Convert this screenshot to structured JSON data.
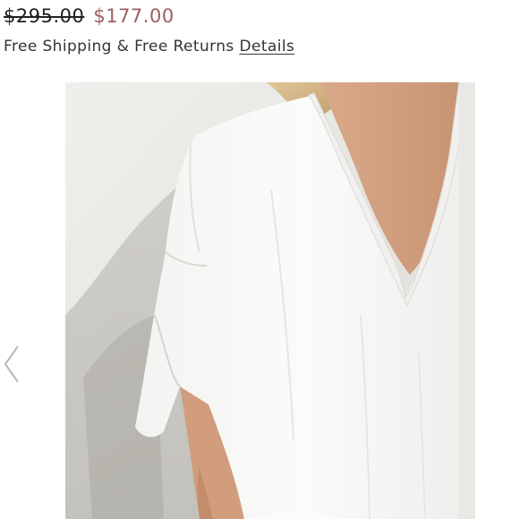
{
  "product": {
    "original_price": "$295.00",
    "sale_price": "$177.00",
    "shipping_text": "Free Shipping & Free Returns",
    "details_link": "Details"
  },
  "gallery": {
    "prev_icon": "chevron-left-icon",
    "image_subject": "product-photo"
  },
  "colors": {
    "sale_price": "#9b5f60",
    "text": "#333333",
    "background": "#ffffff"
  }
}
